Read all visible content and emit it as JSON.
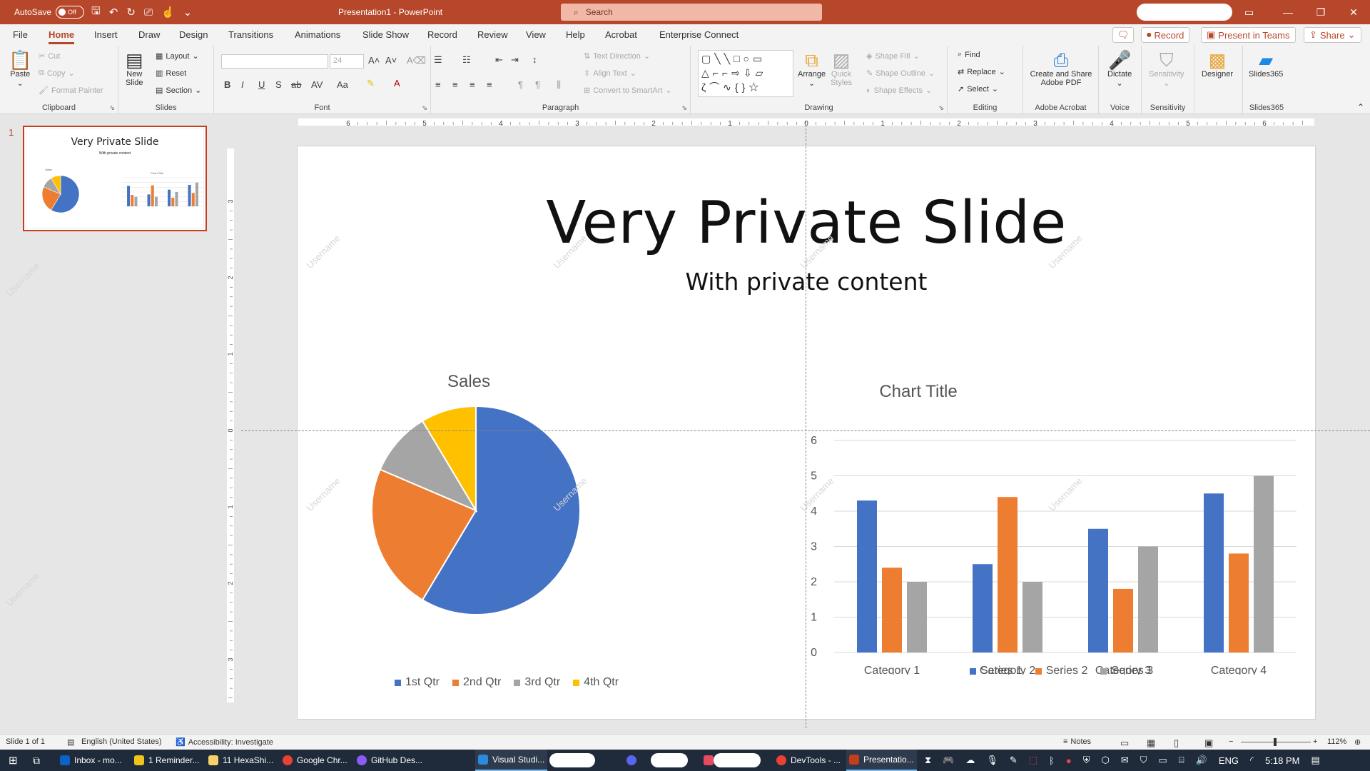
{
  "titlebar": {
    "autosave_label": "AutoSave",
    "autosave_state": "Off",
    "doc_title": "Presentation1  -  PowerPoint",
    "search_placeholder": "Search"
  },
  "tabs": [
    "File",
    "Home",
    "Insert",
    "Draw",
    "Design",
    "Transitions",
    "Animations",
    "Slide Show",
    "Record",
    "Review",
    "View",
    "Help",
    "Acrobat",
    "Enterprise Connect"
  ],
  "active_tab": "Home",
  "tab_actions": {
    "record": "Record",
    "present": "Present in Teams",
    "share": "Share"
  },
  "ribbon": {
    "clipboard": {
      "paste": "Paste",
      "cut": "Cut",
      "copy": "Copy",
      "format_painter": "Format Painter",
      "label": "Clipboard"
    },
    "slides": {
      "new_slide_1": "New",
      "new_slide_2": "Slide",
      "layout": "Layout",
      "reset": "Reset",
      "section": "Section",
      "label": "Slides"
    },
    "font": {
      "size": "24",
      "label": "Font"
    },
    "paragraph": {
      "text_direction": "Text Direction",
      "align_text": "Align Text",
      "smartart": "Convert to SmartArt",
      "label": "Paragraph"
    },
    "drawing": {
      "arrange": "Arrange",
      "quick_styles_1": "Quick",
      "quick_styles_2": "Styles",
      "shape_fill": "Shape Fill",
      "shape_outline": "Shape Outline",
      "shape_effects": "Shape Effects",
      "label": "Drawing"
    },
    "editing": {
      "find": "Find",
      "replace": "Replace",
      "select": "Select",
      "label": "Editing"
    },
    "adobe": {
      "line1": "Create and Share",
      "line2": "Adobe PDF",
      "label": "Adobe Acrobat"
    },
    "voice": {
      "dictate": "Dictate",
      "label": "Voice"
    },
    "sensitivity": {
      "button": "Sensitivity",
      "label": "Sensitivity"
    },
    "designer": {
      "button": "Designer"
    },
    "slides365": {
      "button": "Slides365",
      "label": "Slides365"
    }
  },
  "thumbnail": {
    "number": "1",
    "title": "Very Private Slide",
    "subtitle": "With private content",
    "pie_title": "Sales",
    "bar_title": "Chart Title"
  },
  "ruler": {
    "h_labels": [
      "6",
      "5",
      "4",
      "3",
      "2",
      "1",
      "0",
      "1",
      "2",
      "3",
      "4",
      "5",
      "6"
    ],
    "v_labels": [
      "3",
      "2",
      "1",
      "0",
      "1",
      "2",
      "3"
    ]
  },
  "slide": {
    "title": "Very Private Slide",
    "subtitle": "With private content"
  },
  "watermark": "Username",
  "chart_data": [
    {
      "type": "pie",
      "title": "Sales",
      "categories": [
        "1st Qtr",
        "2nd Qtr",
        "3rd Qtr",
        "4th Qtr"
      ],
      "values": [
        8.2,
        3.2,
        1.4,
        1.2
      ],
      "colors": [
        "#4472c4",
        "#ed7d31",
        "#a5a5a5",
        "#ffc000"
      ],
      "legend": "bottom"
    },
    {
      "type": "bar",
      "title": "Chart Title",
      "categories": [
        "Category 1",
        "Category 2",
        "Category 3",
        "Category 4"
      ],
      "series": [
        {
          "name": "Series 1",
          "values": [
            4.3,
            2.5,
            3.5,
            4.5
          ],
          "color": "#4472c4"
        },
        {
          "name": "Series 2",
          "values": [
            2.4,
            4.4,
            1.8,
            2.8
          ],
          "color": "#ed7d31"
        },
        {
          "name": "Series 3",
          "values": [
            2,
            2,
            3,
            5
          ],
          "color": "#a5a5a5"
        }
      ],
      "yticks": [
        "0",
        "1",
        "2",
        "3",
        "4",
        "5",
        "6"
      ],
      "ylim": [
        0,
        6
      ],
      "grid": true,
      "legend": "bottom"
    }
  ],
  "status": {
    "slide": "Slide 1 of 1",
    "language": "English (United States)",
    "accessibility": "Accessibility: Investigate",
    "notes": "Notes",
    "zoom": "112%"
  },
  "taskbar": {
    "items": [
      "Inbox - mo...",
      "1 Reminder...",
      "11 HexaShi...",
      "Google Chr...",
      "GitHub Des...",
      "Visual Studi...",
      "DevTools - ...",
      "Presentatio..."
    ],
    "lang": "ENG",
    "time": "5:18 PM"
  },
  "colors": {
    "accent": "#b7472a"
  }
}
